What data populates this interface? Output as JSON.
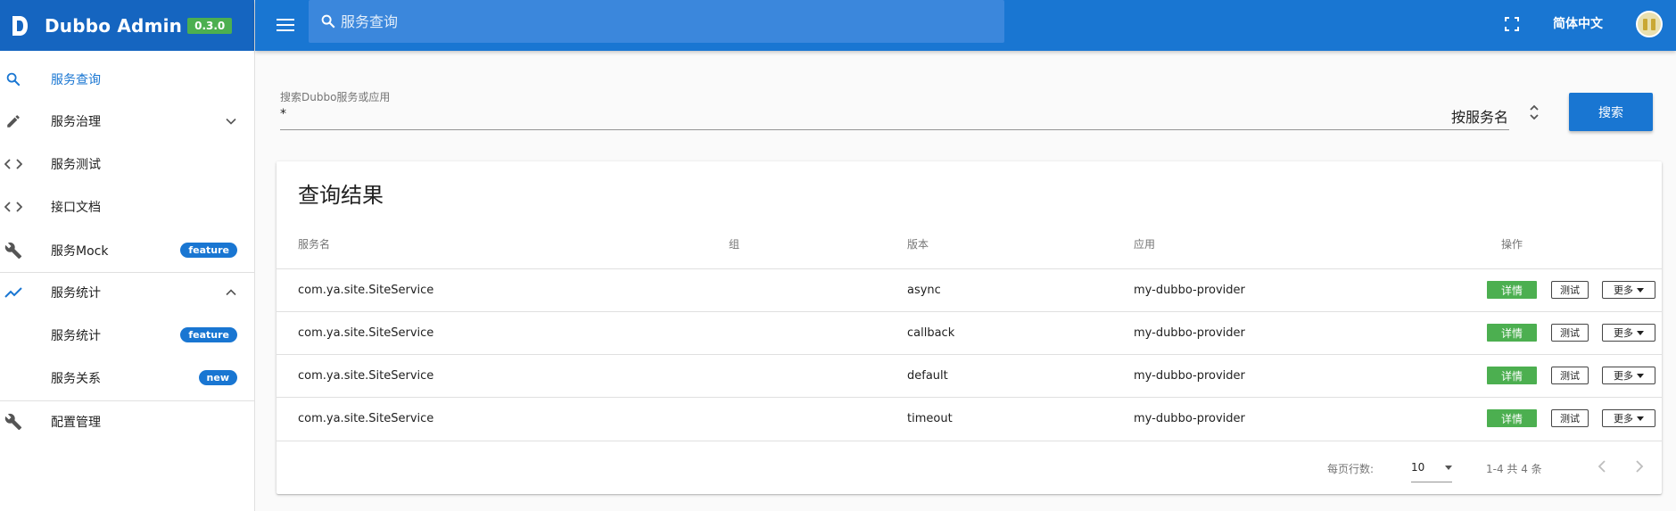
{
  "brand": {
    "title": "Dubbo Admin",
    "version": "0.3.0"
  },
  "topbar": {
    "search_placeholder": "服务查询",
    "language": "简体中文"
  },
  "sidebar": {
    "items": [
      {
        "label": "服务查询",
        "icon": "search-icon",
        "active": true
      },
      {
        "label": "服务治理",
        "icon": "pencil-icon",
        "expandable": true,
        "expanded": false
      },
      {
        "label": "服务测试",
        "icon": "code-icon"
      },
      {
        "label": "接口文档",
        "icon": "code-icon"
      },
      {
        "label": "服务Mock",
        "icon": "wrench-icon",
        "badge": "feature"
      },
      {
        "label": "服务统计",
        "icon": "trending-up-icon",
        "expandable": true,
        "expanded": true
      },
      {
        "label": "服务统计",
        "sub": true,
        "badge": "feature"
      },
      {
        "label": "服务关系",
        "sub": true,
        "badge": "new"
      },
      {
        "label": "配置管理",
        "icon": "wrench-icon"
      }
    ]
  },
  "search": {
    "label": "搜索Dubbo服务或应用",
    "value": "*",
    "type_value": "按服务名",
    "button": "搜索"
  },
  "results": {
    "title": "查询结果",
    "headers": {
      "service": "服务名",
      "group": "组",
      "version": "版本",
      "app": "应用",
      "ops": "操作"
    },
    "rows": [
      {
        "service": "com.ya.site.SiteService",
        "group": "",
        "version": "async",
        "app": "my-dubbo-provider"
      },
      {
        "service": "com.ya.site.SiteService",
        "group": "",
        "version": "callback",
        "app": "my-dubbo-provider"
      },
      {
        "service": "com.ya.site.SiteService",
        "group": "",
        "version": "default",
        "app": "my-dubbo-provider"
      },
      {
        "service": "com.ya.site.SiteService",
        "group": "",
        "version": "timeout",
        "app": "my-dubbo-provider"
      }
    ],
    "actions": {
      "detail": "详情",
      "test": "测试",
      "more": "更多"
    },
    "pagination": {
      "rows_per_page_label": "每页行数:",
      "rows_per_page": "10",
      "info": "1-4 共 4 条"
    }
  },
  "colors": {
    "primary": "#1976d2",
    "brand_dark": "#1565c0",
    "success": "#4caf50"
  }
}
